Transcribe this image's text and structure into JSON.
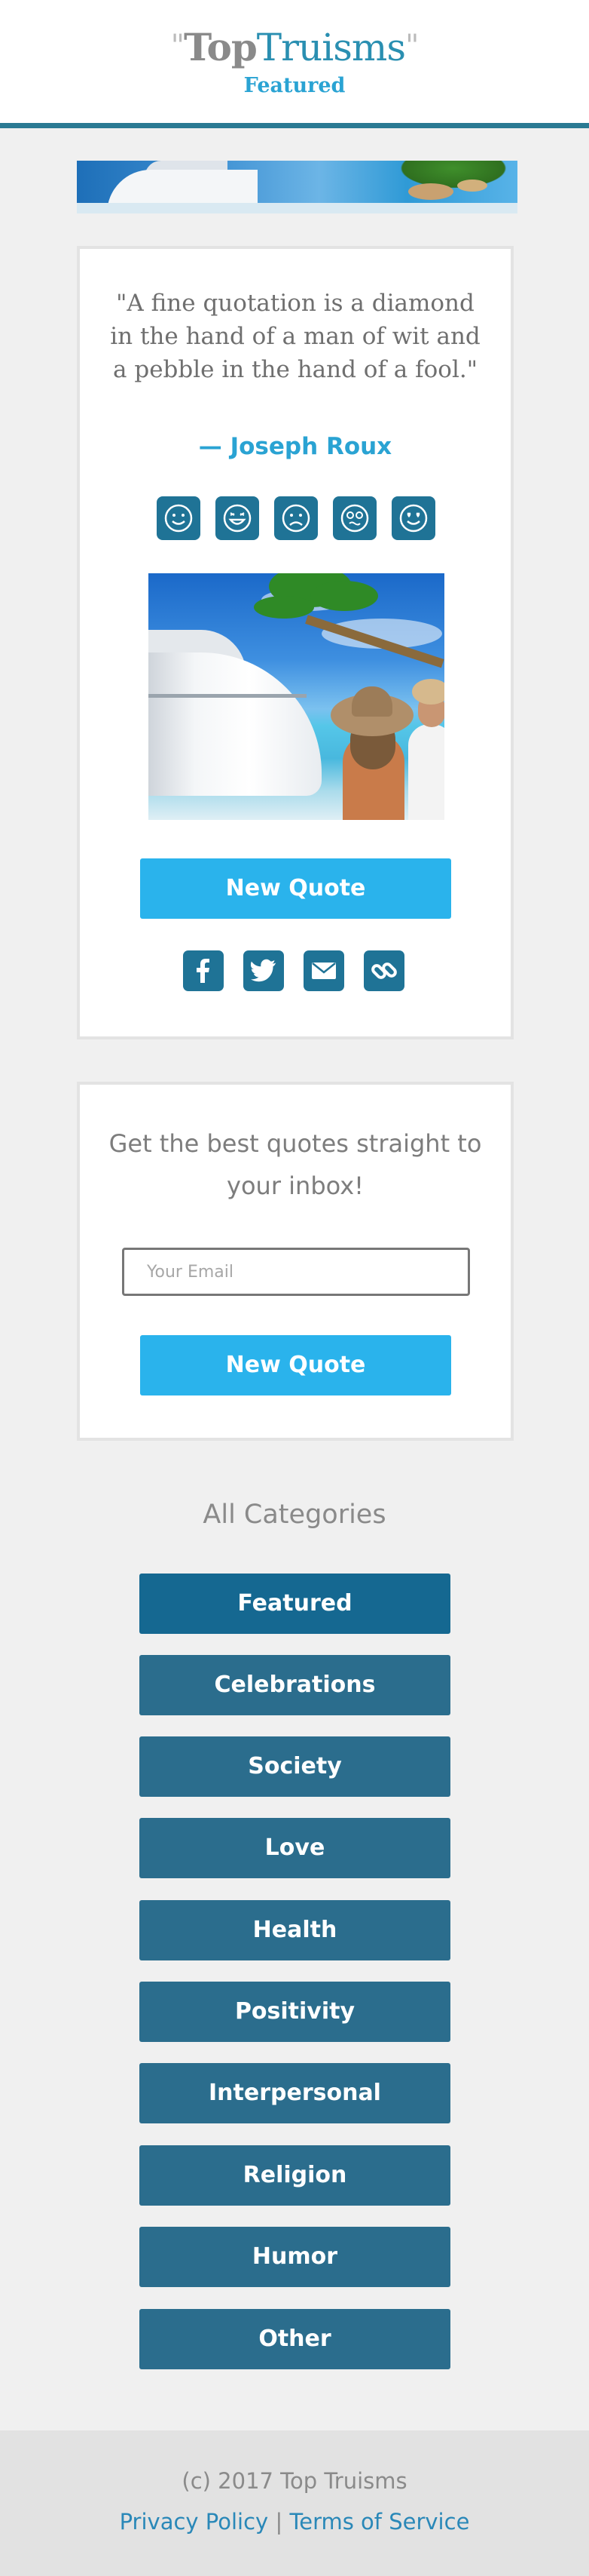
{
  "header": {
    "logo_quote_open": "\"",
    "logo_top": "Top",
    "logo_truisms": "Truisms",
    "logo_quote_close": "\"",
    "section": "Featured"
  },
  "quote": {
    "text": "\"A fine quotation is a diamond in the hand of a man of wit and a pebble in the hand of a fool.\"",
    "author": "— Joseph Roux",
    "reactions": [
      "smile-icon",
      "laugh-icon",
      "sad-icon",
      "surprised-icon",
      "love-icon"
    ],
    "new_quote_label": "New Quote",
    "share": [
      "facebook-icon",
      "twitter-icon",
      "email-icon",
      "link-icon"
    ]
  },
  "signup": {
    "text": "Get the best quotes straight to your inbox!",
    "email_placeholder": "Your Email",
    "button_label": "New Quote"
  },
  "categories": {
    "title": "All Categories",
    "items": [
      {
        "label": "Featured",
        "active": true
      },
      {
        "label": "Celebrations"
      },
      {
        "label": "Society"
      },
      {
        "label": "Love"
      },
      {
        "label": "Health"
      },
      {
        "label": "Positivity"
      },
      {
        "label": "Interpersonal"
      },
      {
        "label": "Religion"
      },
      {
        "label": "Humor"
      },
      {
        "label": "Other"
      }
    ]
  },
  "footer": {
    "copyright": "(c) 2017 Top Truisms",
    "privacy": "Privacy Policy",
    "separator": "|",
    "terms": "Terms of Service"
  },
  "colors": {
    "accent": "#2ab3ec",
    "brand_dark": "#1f7396",
    "category_button": "#2b6d8d",
    "header_rule": "#2a7a93"
  }
}
